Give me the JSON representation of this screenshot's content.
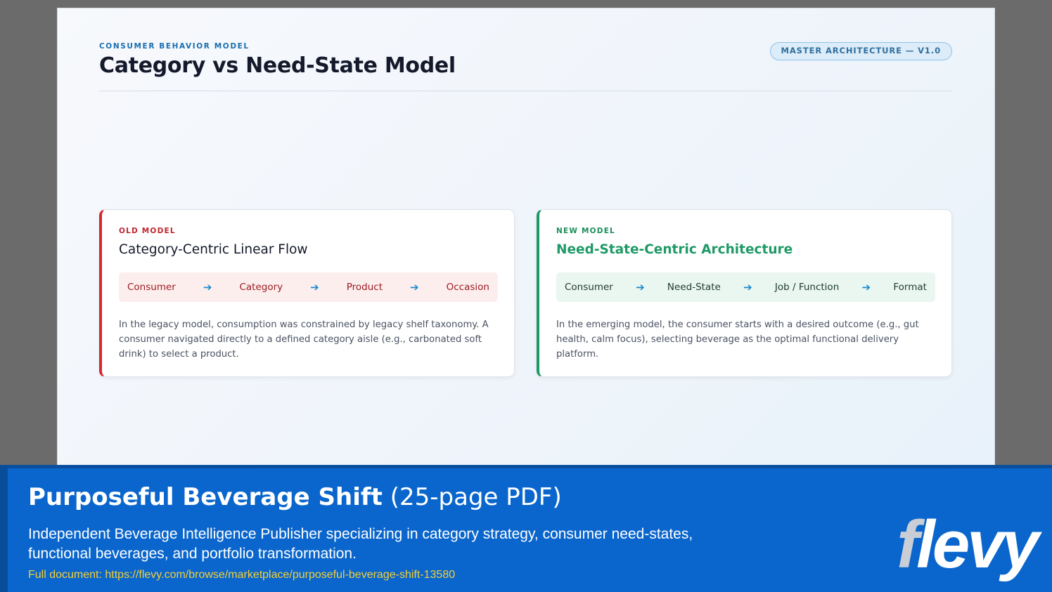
{
  "slide": {
    "eyebrow": "CONSUMER BEHAVIOR MODEL",
    "title": "Category vs Need-State Model",
    "badge": "MASTER ARCHITECTURE — V1.0"
  },
  "old_model": {
    "kicker": "OLD MODEL",
    "title": "Category-Centric Linear Flow",
    "flow": [
      "Consumer",
      "Category",
      "Product",
      "Occasion"
    ],
    "body": "In the legacy model, consumption was constrained by legacy shelf taxonomy. A consumer navigated directly to a defined category aisle (e.g., carbonated soft drink) to select a product.",
    "accent": "#d7262e"
  },
  "new_model": {
    "kicker": "NEW MODEL",
    "title": "Need-State-Centric Architecture",
    "flow": [
      "Consumer",
      "Need-State",
      "Job / Function",
      "Format"
    ],
    "body": "In the emerging model, the consumer starts with a desired outcome (e.g., gut health, calm focus), selecting beverage as the optimal functional delivery platform.",
    "accent": "#1c9a63"
  },
  "arrow_glyph": "➔",
  "banner": {
    "title_bold": "Purposeful Beverage Shift",
    "title_rest": " (25-page PDF)",
    "description": "Independent Beverage Intelligence Publisher specializing in category strategy, consumer need-states, functional beverages, and portfolio transformation.",
    "link": "Full document: https://flevy.com/browse/marketplace/purposeful-beverage-shift-13580",
    "logo_first": "f",
    "logo_rest": "levy",
    "background": "#0a66cc"
  }
}
